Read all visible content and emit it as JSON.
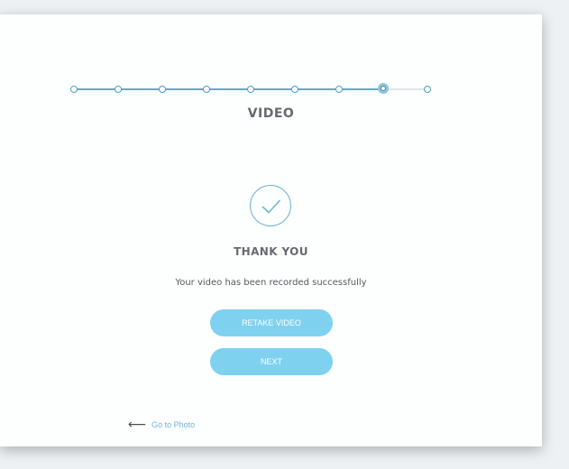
{
  "progress": {
    "total_steps": 9,
    "current_step": 8,
    "fill_color": "#5eabc9",
    "track_color": "#dfe6ea"
  },
  "step": {
    "title": "VIDEO"
  },
  "status": {
    "icon": "checkmark-icon",
    "title": "THANK YOU",
    "message": "Your video has been recorded successfully"
  },
  "actions": {
    "retake_label": "RETAKE VIDEO",
    "next_label": "NEXT",
    "button_color": "#7fd1f0"
  },
  "back_link": {
    "icon": "arrow-left-icon",
    "label": "Go to Photo"
  }
}
